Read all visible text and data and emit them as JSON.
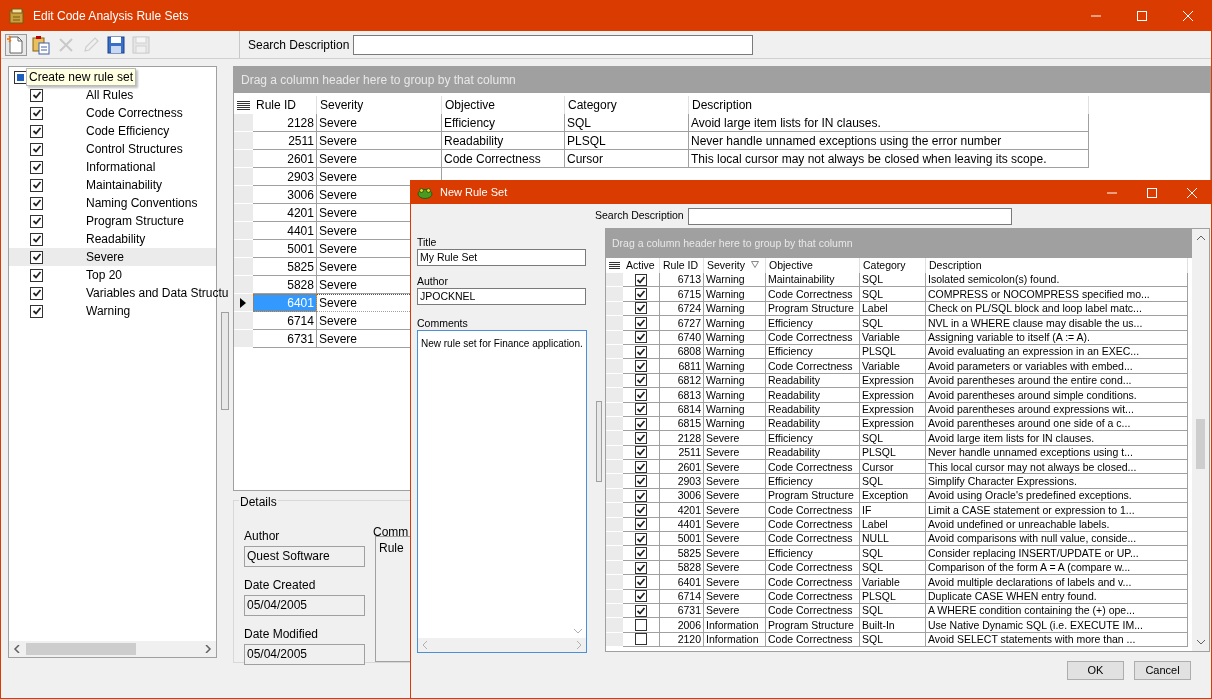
{
  "window": {
    "title": "Edit Code Analysis Rule Sets"
  },
  "toolbar": {
    "buttons": [
      {
        "kind": "new",
        "disabled": false
      },
      {
        "kind": "copy",
        "disabled": false
      },
      {
        "kind": "delete",
        "disabled": true
      },
      {
        "kind": "edit",
        "disabled": true
      },
      {
        "kind": "save",
        "disabled": false
      },
      {
        "kind": "saveas",
        "disabled": true
      }
    ],
    "tooltip": "Create new rule set",
    "search_label": "Search Description"
  },
  "rule_sets": {
    "root": {
      "partial": true
    },
    "items": [
      {
        "label": "All Rules",
        "checked": true,
        "selected": false
      },
      {
        "label": "Code Correctness",
        "checked": true,
        "selected": false
      },
      {
        "label": "Code Efficiency",
        "checked": true,
        "selected": false
      },
      {
        "label": "Control Structures",
        "checked": true,
        "selected": false
      },
      {
        "label": "Informational",
        "checked": true,
        "selected": false
      },
      {
        "label": "Maintainability",
        "checked": true,
        "selected": false
      },
      {
        "label": "Naming Conventions",
        "checked": true,
        "selected": false
      },
      {
        "label": "Program Structure",
        "checked": true,
        "selected": false
      },
      {
        "label": "Readability",
        "checked": true,
        "selected": false
      },
      {
        "label": "Severe",
        "checked": true,
        "selected": true
      },
      {
        "label": "Top 20",
        "checked": true,
        "selected": false
      },
      {
        "label": "Variables and Data Structu",
        "checked": true,
        "selected": false
      },
      {
        "label": "Warning",
        "checked": true,
        "selected": false
      }
    ]
  },
  "grid": {
    "group_hint": "Drag a column header here to group by that column",
    "columns": [
      "Rule ID",
      "Severity",
      "Objective",
      "Category",
      "Description"
    ],
    "rows": [
      {
        "cells": [
          "2128",
          "Severe",
          "Efficiency",
          "SQL",
          "Avoid large item lists for IN clauses."
        ],
        "current": false
      },
      {
        "cells": [
          "2511",
          "Severe",
          "Readability",
          "PLSQL",
          "Never handle unnamed exceptions using the error number"
        ],
        "current": false
      },
      {
        "cells": [
          "2601",
          "Severe",
          "Code Correctness",
          "Cursor",
          "This local cursor may not always be closed when leaving its scope."
        ],
        "current": false
      },
      {
        "cells": [
          "2903",
          "Severe"
        ],
        "current": false
      },
      {
        "cells": [
          "3006",
          "Severe"
        ],
        "current": false
      },
      {
        "cells": [
          "4201",
          "Severe"
        ],
        "current": false
      },
      {
        "cells": [
          "4401",
          "Severe"
        ],
        "current": false
      },
      {
        "cells": [
          "5001",
          "Severe"
        ],
        "current": false
      },
      {
        "cells": [
          "5825",
          "Severe"
        ],
        "current": false
      },
      {
        "cells": [
          "5828",
          "Severe"
        ],
        "current": false
      },
      {
        "cells": [
          "6401",
          "Severe"
        ],
        "current": true
      },
      {
        "cells": [
          "6714",
          "Severe"
        ],
        "current": false
      },
      {
        "cells": [
          "6731",
          "Severe"
        ],
        "current": false
      }
    ]
  },
  "details": {
    "title": "Details",
    "fields": [
      {
        "label": "Author",
        "value": "Quest Software"
      },
      {
        "label": "Date Created",
        "value": "05/04/2005"
      },
      {
        "label": "Date Modified",
        "value": "05/04/2005"
      }
    ],
    "comments_label": "Comm",
    "comments_value": "Rule"
  },
  "dialog": {
    "title": "New Rule Set",
    "search_label": "Search Description",
    "fields": [
      {
        "label": "Title",
        "value": "My Rule Set"
      },
      {
        "label": "Author",
        "value": "JPOCKNEL"
      }
    ],
    "comments_label": "Comments",
    "comments_value": "New rule set for Finance application.",
    "grid": {
      "group_hint": "Drag a column header here to group by that column",
      "columns": [
        {
          "label": "Active",
          "sorted": false
        },
        {
          "label": "Rule ID",
          "sorted": false
        },
        {
          "label": "Severity",
          "sorted": true
        },
        {
          "label": "Objective",
          "sorted": false
        },
        {
          "label": "Category",
          "sorted": false
        },
        {
          "label": "Description",
          "sorted": false
        }
      ],
      "rows": [
        {
          "active": true,
          "rule_id": "6713",
          "severity": "Warning",
          "objective": "Maintainability",
          "category": "SQL",
          "description": "Isolated semicolon(s) found."
        },
        {
          "active": true,
          "rule_id": "6715",
          "severity": "Warning",
          "objective": "Code Correctness",
          "category": "SQL",
          "description": "COMPRESS or NOCOMPRESS specified mo..."
        },
        {
          "active": true,
          "rule_id": "6724",
          "severity": "Warning",
          "objective": "Program Structure",
          "category": "Label",
          "description": "Check on PL/SQL block and loop label matc..."
        },
        {
          "active": true,
          "rule_id": "6727",
          "severity": "Warning",
          "objective": "Efficiency",
          "category": "SQL",
          "description": "NVL in a WHERE clause may disable the us..."
        },
        {
          "active": true,
          "rule_id": "6740",
          "severity": "Warning",
          "objective": "Code Correctness",
          "category": "Variable",
          "description": "Assigning variable to itself (A := A)."
        },
        {
          "active": true,
          "rule_id": "6808",
          "severity": "Warning",
          "objective": "Efficiency",
          "category": "PLSQL",
          "description": "Avoid evaluating an expression in an EXEC..."
        },
        {
          "active": true,
          "rule_id": "6811",
          "severity": "Warning",
          "objective": "Code Correctness",
          "category": "Variable",
          "description": "Avoid parameters or variables with embed..."
        },
        {
          "active": true,
          "rule_id": "6812",
          "severity": "Warning",
          "objective": "Readability",
          "category": "Expression",
          "description": "Avoid parentheses around the entire cond..."
        },
        {
          "active": true,
          "rule_id": "6813",
          "severity": "Warning",
          "objective": "Readability",
          "category": "Expression",
          "description": "Avoid parentheses around simple conditions."
        },
        {
          "active": true,
          "rule_id": "6814",
          "severity": "Warning",
          "objective": "Readability",
          "category": "Expression",
          "description": "Avoid parentheses around expressions wit..."
        },
        {
          "active": true,
          "rule_id": "6815",
          "severity": "Warning",
          "objective": "Readability",
          "category": "Expression",
          "description": "Avoid parentheses around one side of a c..."
        },
        {
          "active": true,
          "rule_id": "2128",
          "severity": "Severe",
          "objective": "Efficiency",
          "category": "SQL",
          "description": "Avoid large item lists for IN clauses."
        },
        {
          "active": true,
          "rule_id": "2511",
          "severity": "Severe",
          "objective": "Readability",
          "category": "PLSQL",
          "description": "Never handle unnamed exceptions using t..."
        },
        {
          "active": true,
          "rule_id": "2601",
          "severity": "Severe",
          "objective": "Code Correctness",
          "category": "Cursor",
          "description": "This local cursor may not always be closed..."
        },
        {
          "active": true,
          "rule_id": "2903",
          "severity": "Severe",
          "objective": "Efficiency",
          "category": "SQL",
          "description": "Simplify Character Expressions."
        },
        {
          "active": true,
          "rule_id": "3006",
          "severity": "Severe",
          "objective": "Program Structure",
          "category": "Exception",
          "description": "Avoid using Oracle's predefined exceptions."
        },
        {
          "active": true,
          "rule_id": "4201",
          "severity": "Severe",
          "objective": "Code Correctness",
          "category": "IF",
          "description": "Limit a CASE statement or expression to 1..."
        },
        {
          "active": true,
          "rule_id": "4401",
          "severity": "Severe",
          "objective": "Code Correctness",
          "category": "Label",
          "description": "Avoid undefined or unreachable labels."
        },
        {
          "active": true,
          "rule_id": "5001",
          "severity": "Severe",
          "objective": "Code Correctness",
          "category": "NULL",
          "description": "Avoid comparisons with null value, conside..."
        },
        {
          "active": true,
          "rule_id": "5825",
          "severity": "Severe",
          "objective": "Efficiency",
          "category": "SQL",
          "description": "Consider replacing INSERT/UPDATE or UP..."
        },
        {
          "active": true,
          "rule_id": "5828",
          "severity": "Severe",
          "objective": "Code Correctness",
          "category": "SQL",
          "description": "Comparison of the form A = A (compare w..."
        },
        {
          "active": true,
          "rule_id": "6401",
          "severity": "Severe",
          "objective": "Code Correctness",
          "category": "Variable",
          "description": "Avoid multiple declarations of labels and v..."
        },
        {
          "active": true,
          "rule_id": "6714",
          "severity": "Severe",
          "objective": "Code Correctness",
          "category": "PLSQL",
          "description": "Duplicate CASE WHEN entry found."
        },
        {
          "active": true,
          "rule_id": "6731",
          "severity": "Severe",
          "objective": "Code Correctness",
          "category": "SQL",
          "description": "A WHERE condition containing the (+) ope..."
        },
        {
          "active": false,
          "rule_id": "2006",
          "severity": "Information",
          "objective": "Program Structure",
          "category": "Built-In",
          "description": "Use Native Dynamic SQL (i.e. EXECUTE IM..."
        },
        {
          "active": false,
          "rule_id": "2120",
          "severity": "Information",
          "objective": "Code Correctness",
          "category": "SQL",
          "description": "Avoid SELECT statements with more than ..."
        }
      ]
    },
    "buttons": [
      "OK",
      "Cancel"
    ]
  }
}
